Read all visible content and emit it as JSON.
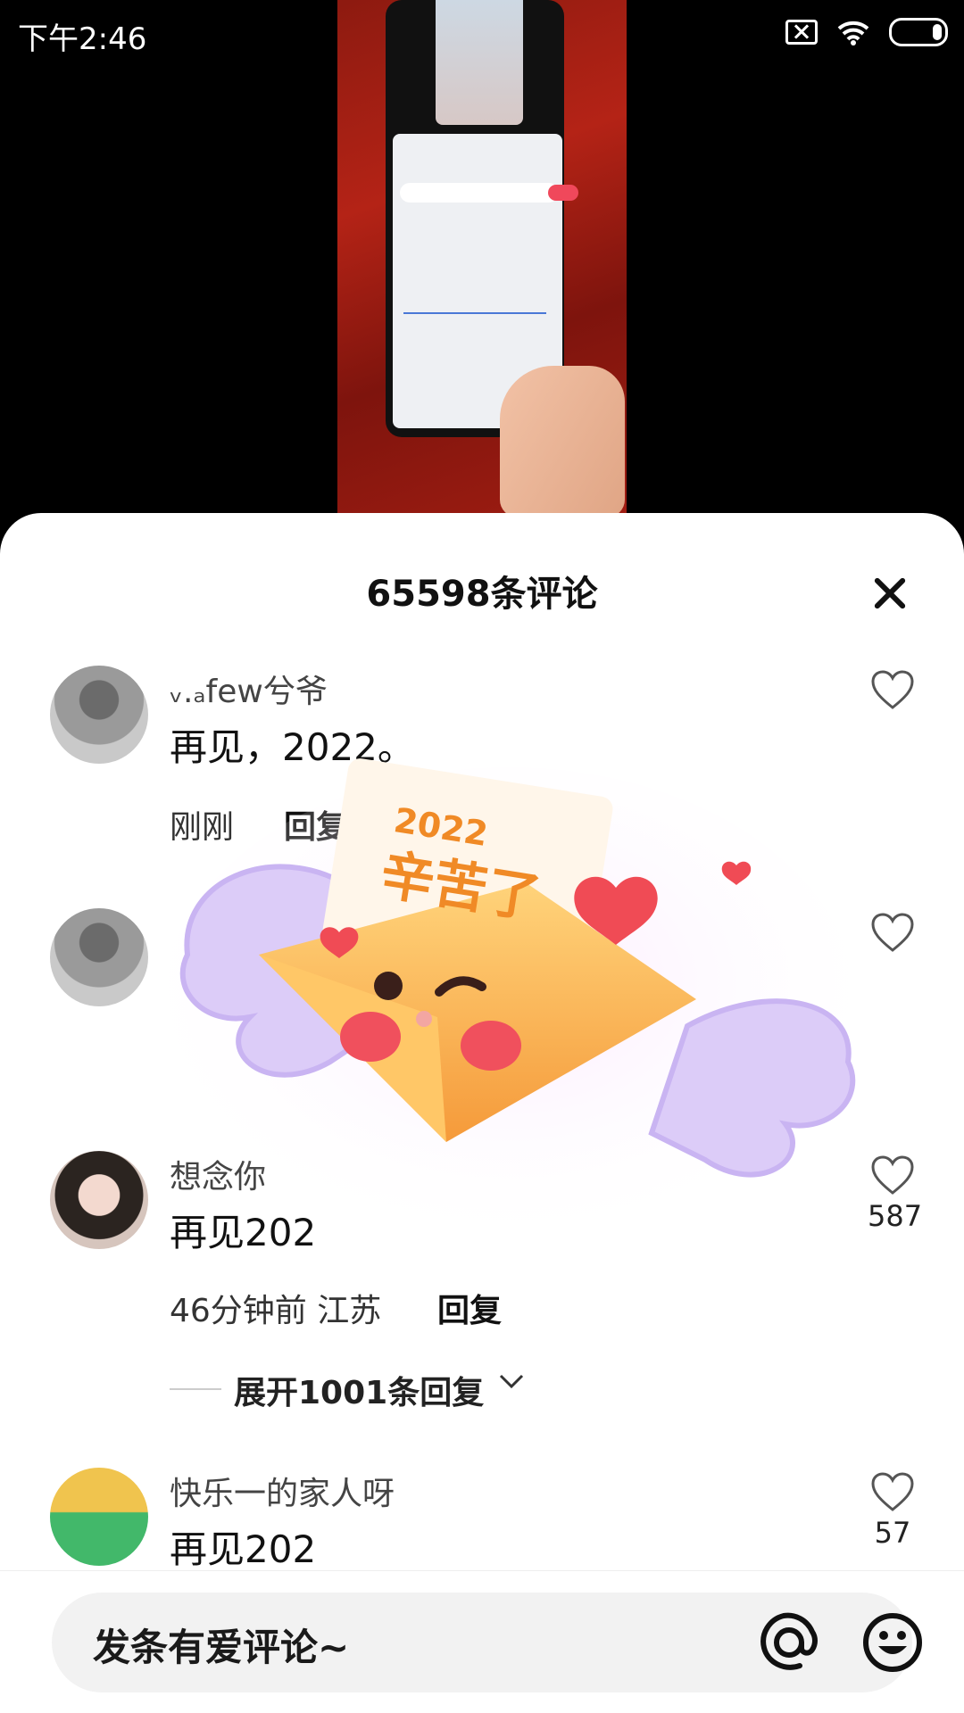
{
  "status_bar": {
    "time": "下午2:46"
  },
  "sheet": {
    "title": "65598条评论"
  },
  "comments": [
    {
      "username": "ᵥ.ₐfew兮爷",
      "text": "再见，2022。",
      "time": "刚刚",
      "reply_label": "回复",
      "likes": ""
    },
    {
      "username": "",
      "text": "",
      "time": "",
      "reply_label": "",
      "likes": ""
    },
    {
      "username": "想念你",
      "text": "再见202",
      "time": "46分钟前 江苏",
      "reply_label": "回复",
      "likes": "587",
      "expand_label": "展开1001条回复"
    },
    {
      "username": "快乐一的家人呀",
      "text": "再见202",
      "likes": "57"
    }
  ],
  "sticker": {
    "year": "2022",
    "message": "辛苦了"
  },
  "input": {
    "placeholder": "发条有爱评论~"
  },
  "icons": {
    "like": "heart-outline-icon",
    "close": "close-icon",
    "mention": "at-icon",
    "emoji": "emoji-icon",
    "expand": "chevron-down-icon"
  },
  "colors": {
    "sticker_envelope": "#f7b85a",
    "sticker_wings": "#d8c7f6",
    "heart": "#f04b55"
  }
}
